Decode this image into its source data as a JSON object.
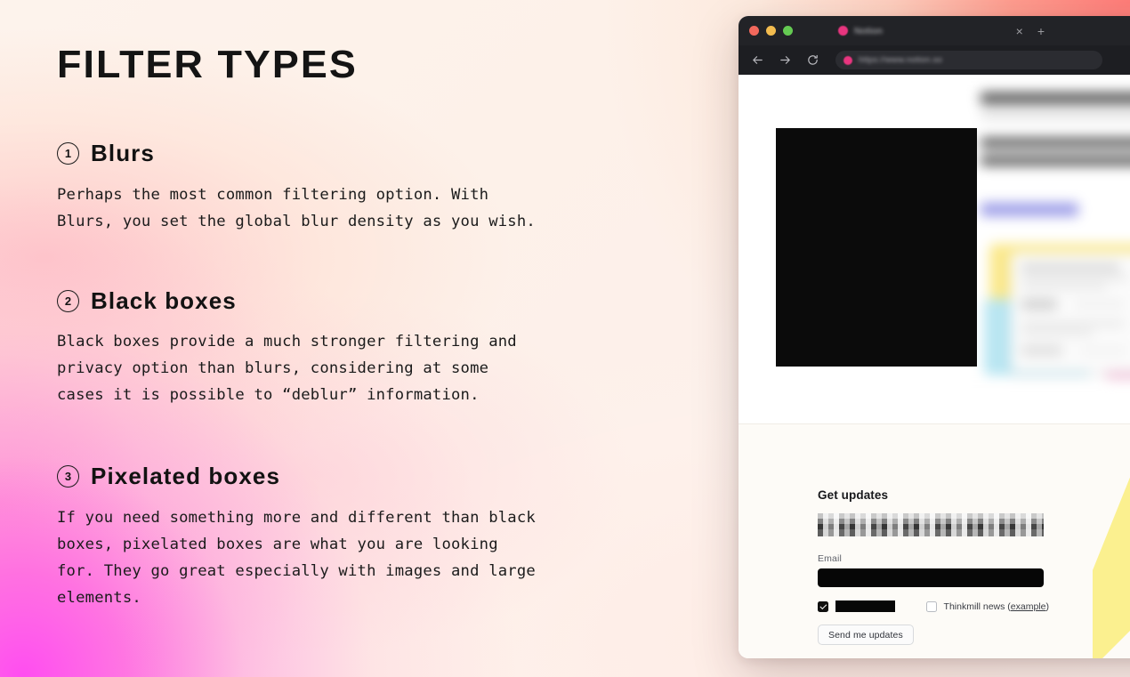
{
  "page": {
    "title": "FILTER TYPES"
  },
  "sections": [
    {
      "number": "1",
      "title": "Blurs",
      "body": "Perhaps the most common filtering option. With\nBlurs, you set the global blur density as you wish."
    },
    {
      "number": "2",
      "title": "Black boxes",
      "body": "Black boxes provide a much stronger filtering and\nprivacy option than blurs, considering at some\ncases it is possible to “deblur” information."
    },
    {
      "number": "3",
      "title": "Pixelated boxes",
      "body": "If you need something more and different than black\nboxes, pixelated boxes are what you are looking\nfor. They go great especially with images and large\nelements."
    }
  ],
  "browser": {
    "tab": {
      "title": "Notion",
      "close_label": "×",
      "new_tab_label": "+"
    },
    "toolbar": {
      "back_label": "back-arrow",
      "forward_label": "forward-arrow",
      "reload_label": "reload"
    },
    "address_bar": {
      "url": "https://www.notion.so"
    },
    "form": {
      "heading": "Get updates",
      "email_label": "Email",
      "email_value": "",
      "checkbox_1_label": "",
      "checkbox_1_checked": true,
      "checkbox_2_label_prefix": "Thinkmill news (",
      "checkbox_2_label_link": "example",
      "checkbox_2_label_suffix": ")",
      "checkbox_2_checked": false,
      "submit_label": "Send me updates"
    }
  },
  "colors": {
    "accent_pink": "#e8357f",
    "highlight_yellow": "#fbf08f",
    "redaction_black": "#0b0b0b",
    "chrome_dark": "#222327"
  }
}
